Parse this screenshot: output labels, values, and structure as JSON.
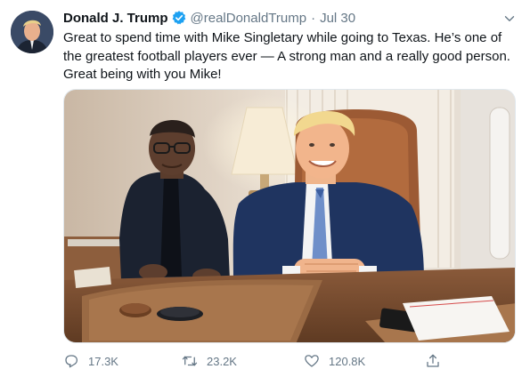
{
  "tweet": {
    "author_name": "Donald J. Trump",
    "handle": "@realDonaldTrump",
    "separator": "·",
    "date": "Jul 30",
    "text": "Great to spend time with Mike Singletary while going to Texas. He’s one of the greatest football players ever — A strong man and a really good person. Great being with you Mike!"
  },
  "icons": {
    "verified": "verified-badge-icon",
    "more": "chevron-down-icon",
    "reply": "reply-icon",
    "retweet": "retweet-icon",
    "like": "heart-icon",
    "share": "share-icon"
  },
  "actions": {
    "replies": "17.3K",
    "retweets": "23.2K",
    "likes": "120.8K"
  },
  "colors": {
    "verified_blue": "#1da1f2",
    "secondary_text": "#657786",
    "primary_text": "#0f1419"
  }
}
